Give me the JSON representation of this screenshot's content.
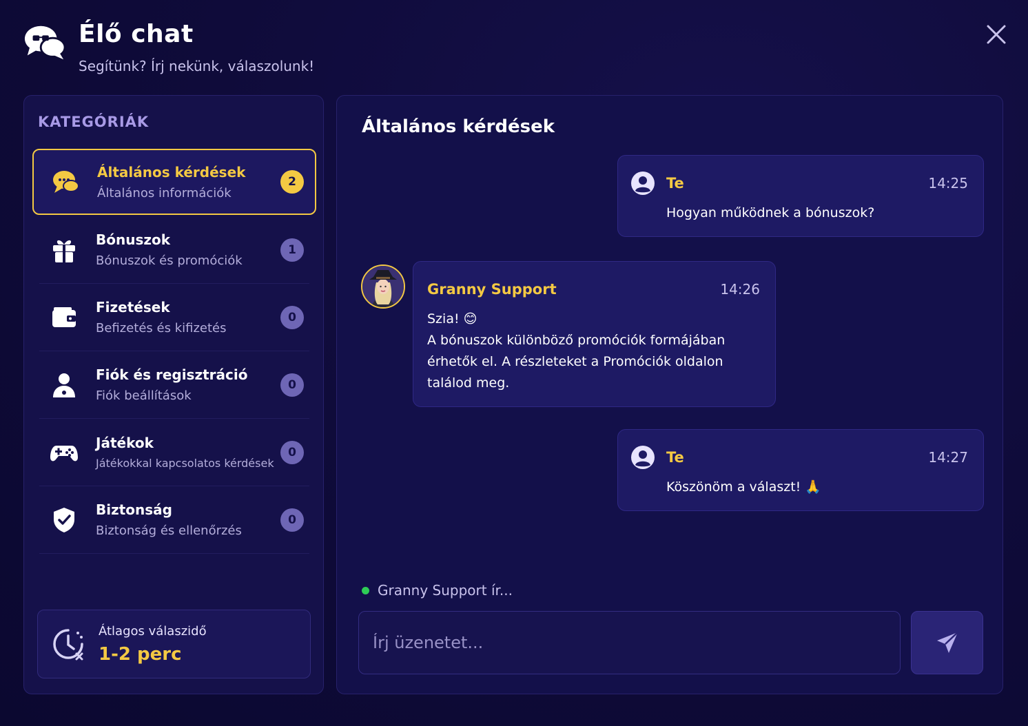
{
  "header": {
    "title": "Élő chat",
    "subtitle": "Segítünk? Írj nekünk, válaszolunk!",
    "logo_icon": "chat-bubbles-icon",
    "close_icon": "close-icon"
  },
  "colors": {
    "background": "#0d0a33",
    "panel": "#15114a",
    "accent": "#f4c943",
    "online": "#2ecc56",
    "badge": "#6e66b5"
  },
  "sidebar": {
    "heading": "KATEGÓRIÁK",
    "categories": [
      {
        "title": "Általános kérdések",
        "subtitle": "Általános információk",
        "count": "2",
        "icon": "chat-bubble-icon",
        "active": true
      },
      {
        "title": "Bónuszok",
        "subtitle": "Bónuszok és promóciók",
        "count": "1",
        "icon": "gift-icon",
        "active": false
      },
      {
        "title": "Fizetések",
        "subtitle": "Befizetés és kifizetés",
        "count": "0",
        "icon": "wallet-icon",
        "active": false
      },
      {
        "title": "Fiók és regisztráció",
        "subtitle": "Fiók beállítások",
        "count": "0",
        "icon": "user-icon",
        "active": false
      },
      {
        "title": "Játékok",
        "subtitle": "Játékokkal kapcsolatos kérdések",
        "count": "0",
        "icon": "gamepad-icon",
        "active": false
      },
      {
        "title": "Biztonság",
        "subtitle": "Biztonság és ellenőrzés",
        "count": "0",
        "icon": "shield-check-icon",
        "active": false
      }
    ],
    "avg_response": {
      "label": "Átlagos válaszidő",
      "value": "1-2 perc",
      "icon": "clock-icon"
    }
  },
  "chat": {
    "title": "Általános kérdések",
    "messages": [
      {
        "sender": "Te",
        "time": "14:25",
        "text": "Hogyan működnek a bónuszok?"
      },
      {
        "sender": "Granny Support",
        "time": "14:26",
        "text_line1": "Szia! 😊",
        "text_line2": "A bónuszok különböző promóciók formájában érhetők el. A részleteket a Promóciók oldalon találod meg."
      },
      {
        "sender": "Te",
        "time": "14:27",
        "text": "Köszönöm a választ! 🙏"
      }
    ],
    "typing": "Granny Support ír...",
    "input_placeholder": "Írj üzenetet...",
    "send_icon": "send-icon"
  }
}
